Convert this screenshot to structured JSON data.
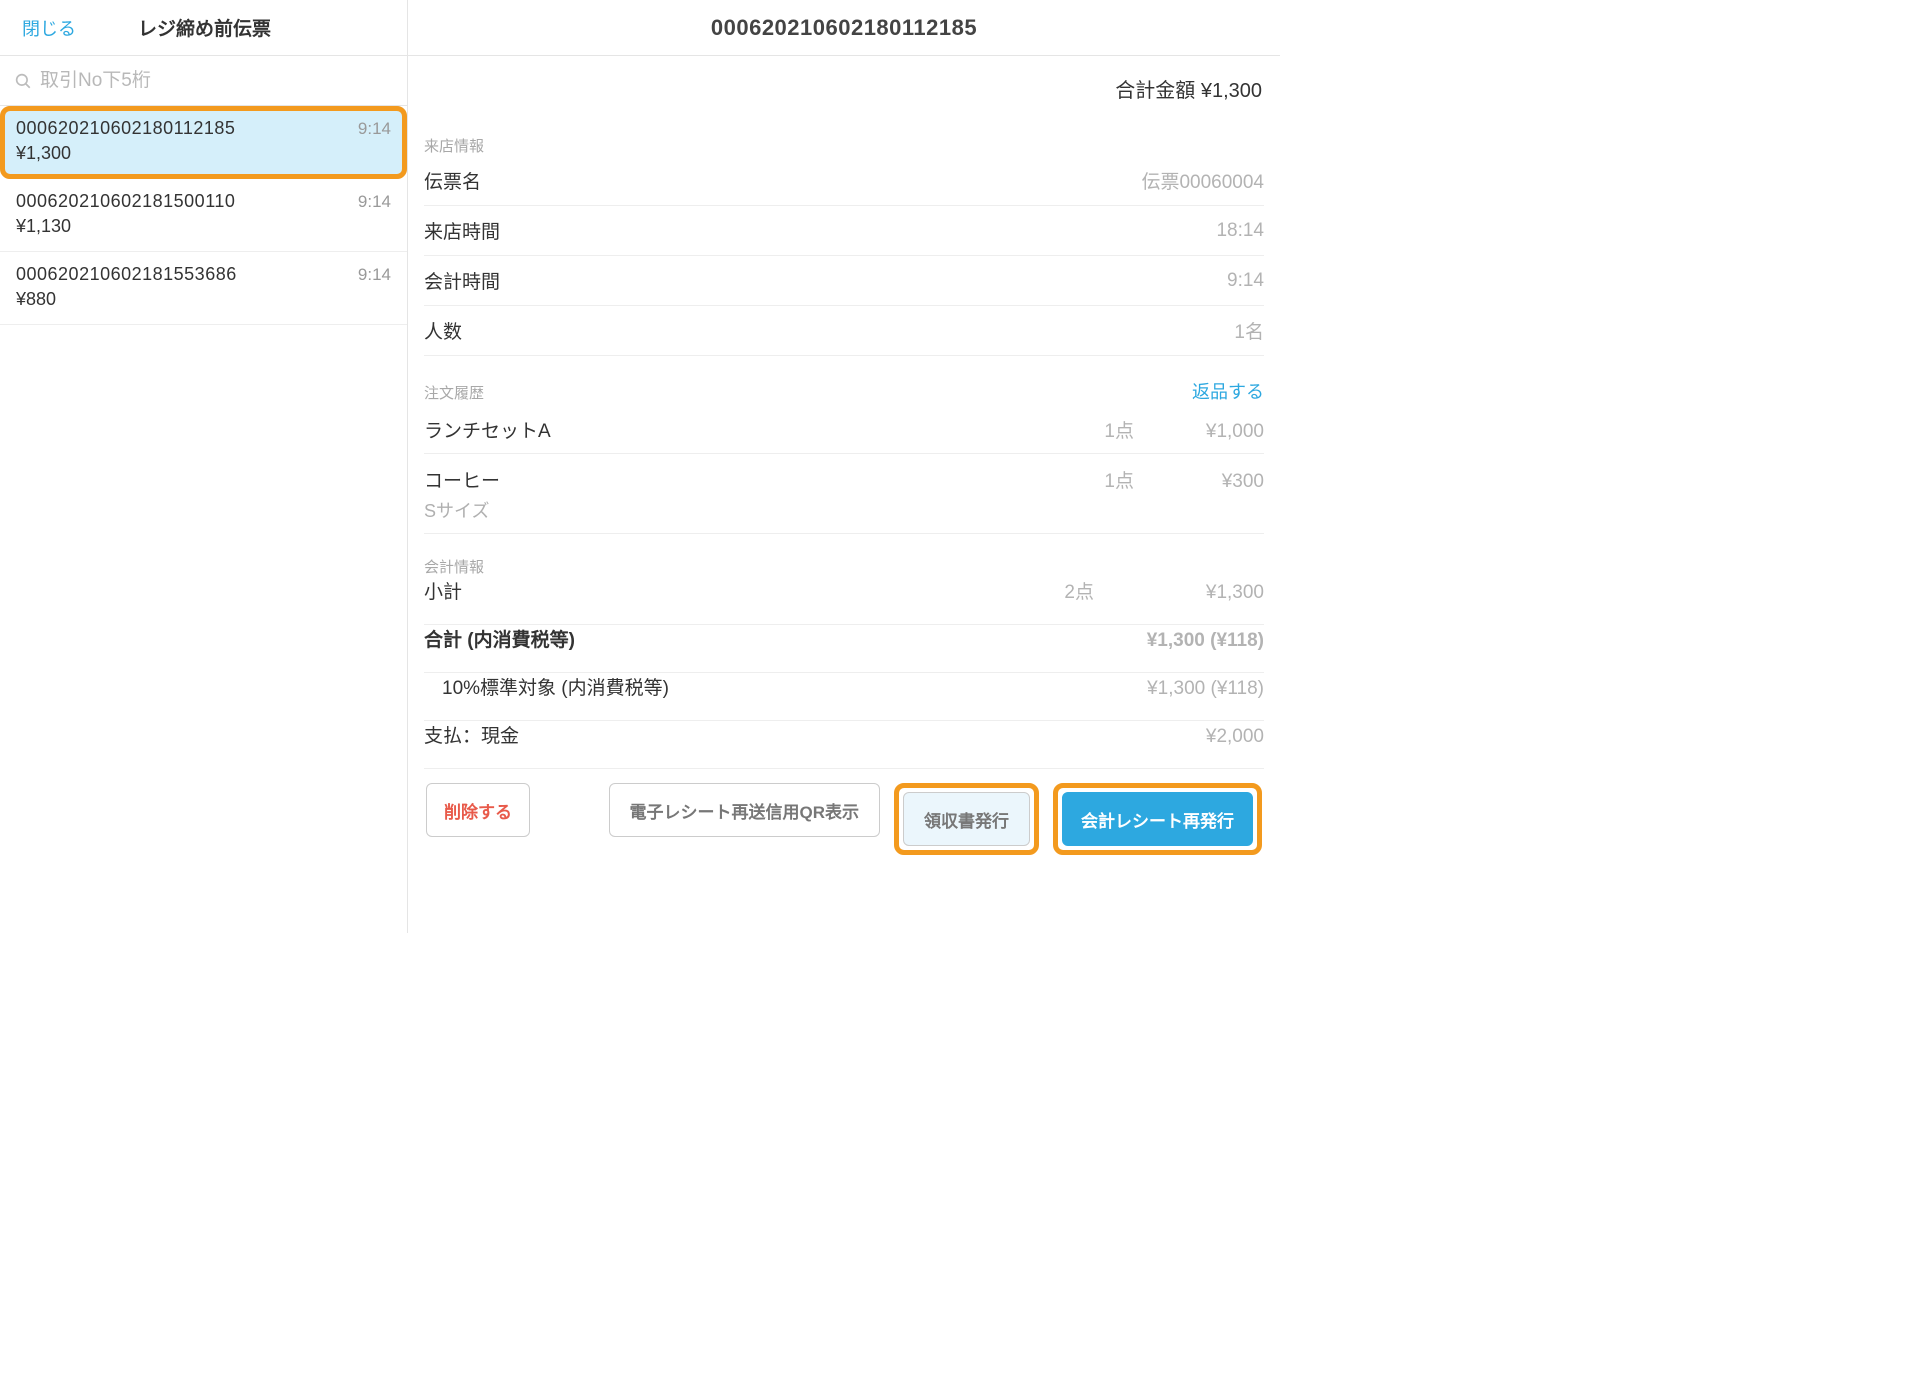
{
  "header": {
    "close": "閉じる",
    "leftTitle": "レジ締め前伝票",
    "rightTitle": "000620210602180112185"
  },
  "search": {
    "placeholder": "取引No下5桁"
  },
  "receipts": [
    {
      "no": "000620210602180112185",
      "time": "9:14",
      "amount": "¥1,300",
      "selected": true,
      "highlighted": true
    },
    {
      "no": "000620210602181500110",
      "time": "9:14",
      "amount": "¥1,130",
      "selected": false,
      "highlighted": false
    },
    {
      "no": "000620210602181553686",
      "time": "9:14",
      "amount": "¥880",
      "selected": false,
      "highlighted": false
    }
  ],
  "detail": {
    "totalLabel": "合計金額 ¥1,300",
    "visitSection": "来店情報",
    "visitRows": [
      {
        "k": "伝票名",
        "v": "伝票00060004"
      },
      {
        "k": "来店時間",
        "v": "18:14"
      },
      {
        "k": "会計時間",
        "v": "9:14"
      },
      {
        "k": "人数",
        "v": "1名"
      }
    ],
    "ordersSection": "注文履歴",
    "returnLabel": "返品する",
    "orders": [
      {
        "name": "ランチセットA",
        "qty": "1点",
        "price": "¥1,000",
        "note": ""
      },
      {
        "name": "コーヒー",
        "qty": "1点",
        "price": "¥300",
        "note": "Sサイズ"
      }
    ],
    "calcSection": "会計情報",
    "calcRows": [
      {
        "k": "小計",
        "count": "2点",
        "v": "¥1,300",
        "bold": false,
        "indent": false
      },
      {
        "k": "合計 (内消費税等)",
        "count": "",
        "v": "¥1,300 (¥118)",
        "bold": true,
        "indent": false
      },
      {
        "k": "10%標準対象 (内消費税等)",
        "count": "",
        "v": "¥1,300 (¥118)",
        "bold": false,
        "indent": true
      },
      {
        "k": "支払：現金",
        "count": "",
        "v": "¥2,000",
        "bold": false,
        "indent": false
      }
    ]
  },
  "actions": {
    "delete": "削除する",
    "qr": "電子レシート再送信用QR表示",
    "invoice": "領収書発行",
    "reprint": "会計レシート再発行"
  }
}
